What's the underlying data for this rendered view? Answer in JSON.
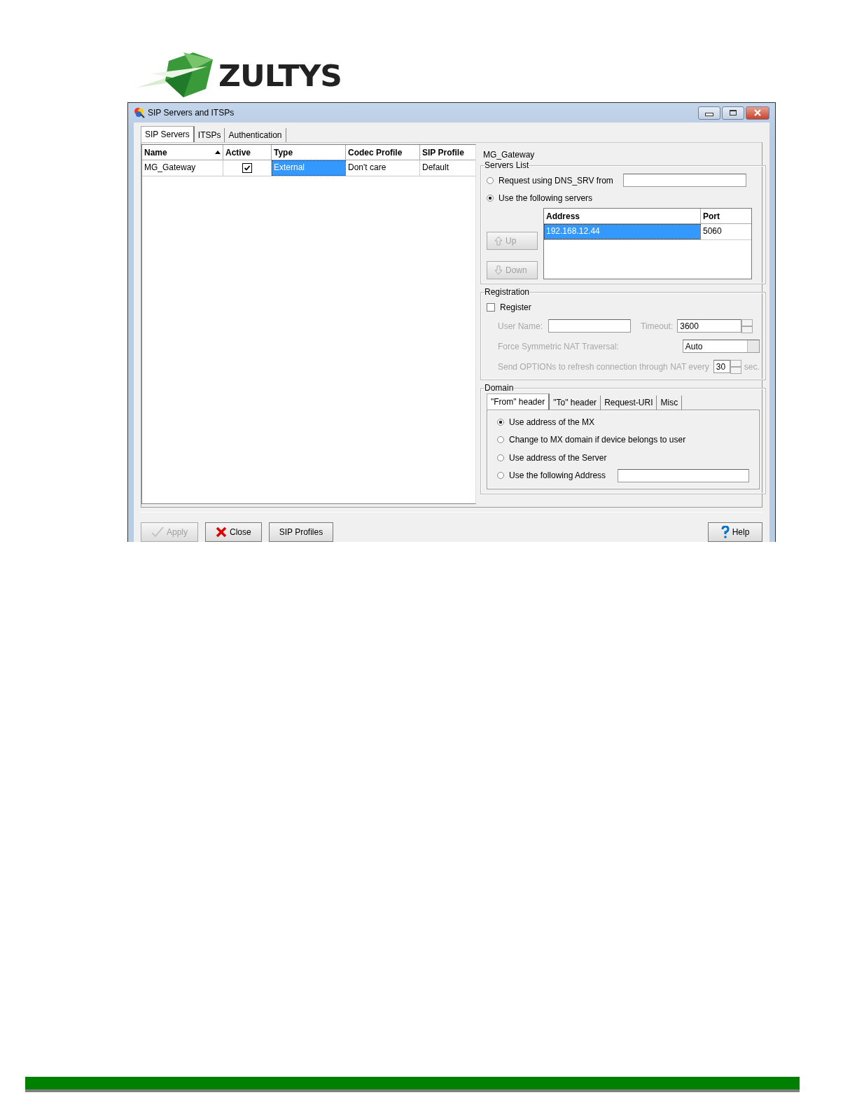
{
  "logo": {
    "text": "ZULTYS"
  },
  "window": {
    "title": "SIP Servers and ITSPs",
    "tabs": [
      {
        "label": "SIP Servers",
        "selected": true
      },
      {
        "label": "ITSPs",
        "selected": false
      },
      {
        "label": "Authentication",
        "selected": false
      }
    ],
    "table": {
      "columns": [
        {
          "label": "Name",
          "sorted": true
        },
        {
          "label": "Active",
          "sorted": false
        },
        {
          "label": "Type",
          "sorted": false
        },
        {
          "label": "Codec Profile",
          "sorted": false
        },
        {
          "label": "SIP Profile",
          "sorted": false
        }
      ],
      "rows": [
        {
          "name": "MG_Gateway",
          "active": true,
          "type": "External",
          "codec_profile": "Don't care",
          "sip_profile": "Default",
          "selected": true
        }
      ]
    },
    "detail": {
      "name": "MG_Gateway",
      "servers_list": {
        "title": "Servers List",
        "options": [
          {
            "label": "Request using DNS_SRV from",
            "selected": false,
            "kind": "field"
          },
          {
            "label": "Use the following servers",
            "selected": true,
            "kind": "plain"
          }
        ],
        "buttons": [
          {
            "label": "Up",
            "disabled": true
          },
          {
            "label": "Down",
            "disabled": true
          }
        ],
        "columns": [
          "Address",
          "Port"
        ],
        "rows": [
          {
            "address": "192.168.12.44",
            "port": "5060",
            "selected": true
          }
        ]
      },
      "registration": {
        "title": "Registration",
        "disabled": true,
        "register": {
          "label": "Register",
          "checked": false
        },
        "user_name_label": "User Name:",
        "timeout_label": "Timeout:",
        "timeout": "3600",
        "nat_label": "Force Symmetric NAT Traversal:",
        "nat_value": "Auto",
        "options_label": "Send OPTIONs to refresh connection through NAT every",
        "options_value": "30",
        "options_unit": "sec."
      },
      "domain": {
        "title": "Domain",
        "tabs": [
          {
            "label": "\"From\" header",
            "selected": true
          },
          {
            "label": "\"To\" header",
            "selected": false
          },
          {
            "label": "Request-URI",
            "selected": false
          },
          {
            "label": "Misc",
            "selected": false
          }
        ],
        "options": [
          {
            "label": "Use address of the MX",
            "selected": true,
            "kind": "plain"
          },
          {
            "label": "Change to MX domain if device belongs to user",
            "selected": false,
            "kind": "plain"
          },
          {
            "label": "Use address of the Server",
            "selected": false,
            "kind": "plain"
          },
          {
            "label": "Use the following Address",
            "selected": false,
            "kind": "field"
          }
        ]
      }
    },
    "buttons": [
      {
        "label": "Apply",
        "disabled": true
      },
      {
        "label": "Close",
        "disabled": false
      },
      {
        "label": "SIP Profiles",
        "disabled": false
      },
      {
        "label": "Help",
        "disabled": false
      }
    ]
  }
}
